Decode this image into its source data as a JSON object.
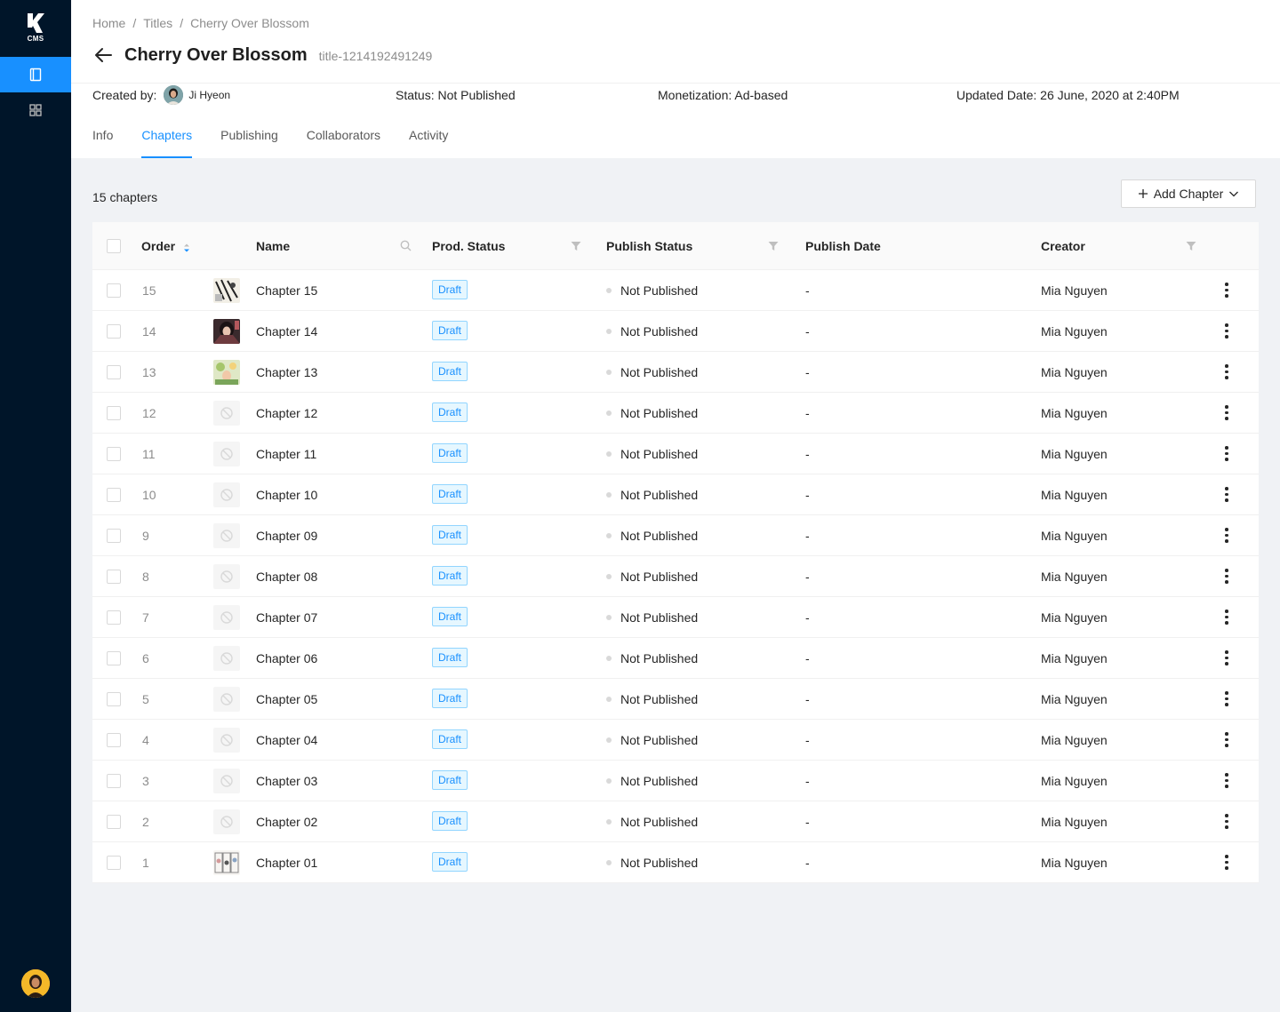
{
  "app": {
    "logo_text": "CMS"
  },
  "breadcrumb": [
    "Home",
    "Titles",
    "Cherry Over Blossom"
  ],
  "title": {
    "name": "Cherry Over Blossom",
    "id": "title-1214192491249"
  },
  "meta": {
    "created_by_label": "Created by:",
    "created_by_user": "Ji Hyeon",
    "status": "Status: Not Published",
    "monetization": "Monetization: Ad-based",
    "updated": "Updated Date: 26 June, 2020 at 2:40PM"
  },
  "tabs": [
    {
      "label": "Info",
      "active": false
    },
    {
      "label": "Chapters",
      "active": true
    },
    {
      "label": "Publishing",
      "active": false
    },
    {
      "label": "Collaborators",
      "active": false
    },
    {
      "label": "Activity",
      "active": false
    }
  ],
  "chapter_count": "15 chapters",
  "add_button": "Add Chapter",
  "columns": {
    "order": "Order",
    "name": "Name",
    "prod_status": "Prod. Status",
    "publish_status": "Publish Status",
    "publish_date": "Publish Date",
    "creator": "Creator"
  },
  "rows": [
    {
      "order": "15",
      "name": "Chapter 15",
      "prod_status": "Draft",
      "publish_status": "Not Published",
      "publish_date": "-",
      "creator": "Mia Nguyen",
      "thumb": "manga-a"
    },
    {
      "order": "14",
      "name": "Chapter 14",
      "prod_status": "Draft",
      "publish_status": "Not Published",
      "publish_date": "-",
      "creator": "Mia Nguyen",
      "thumb": "manga-b"
    },
    {
      "order": "13",
      "name": "Chapter 13",
      "prod_status": "Draft",
      "publish_status": "Not Published",
      "publish_date": "-",
      "creator": "Mia Nguyen",
      "thumb": "manga-c"
    },
    {
      "order": "12",
      "name": "Chapter 12",
      "prod_status": "Draft",
      "publish_status": "Not Published",
      "publish_date": "-",
      "creator": "Mia Nguyen",
      "thumb": "none"
    },
    {
      "order": "11",
      "name": "Chapter 11",
      "prod_status": "Draft",
      "publish_status": "Not Published",
      "publish_date": "-",
      "creator": "Mia Nguyen",
      "thumb": "none"
    },
    {
      "order": "10",
      "name": "Chapter 10",
      "prod_status": "Draft",
      "publish_status": "Not Published",
      "publish_date": "-",
      "creator": "Mia Nguyen",
      "thumb": "none"
    },
    {
      "order": "9",
      "name": "Chapter 09",
      "prod_status": "Draft",
      "publish_status": "Not Published",
      "publish_date": "-",
      "creator": "Mia Nguyen",
      "thumb": "none"
    },
    {
      "order": "8",
      "name": "Chapter 08",
      "prod_status": "Draft",
      "publish_status": "Not Published",
      "publish_date": "-",
      "creator": "Mia Nguyen",
      "thumb": "none"
    },
    {
      "order": "7",
      "name": "Chapter 07",
      "prod_status": "Draft",
      "publish_status": "Not Published",
      "publish_date": "-",
      "creator": "Mia Nguyen",
      "thumb": "none"
    },
    {
      "order": "6",
      "name": "Chapter 06",
      "prod_status": "Draft",
      "publish_status": "Not Published",
      "publish_date": "-",
      "creator": "Mia Nguyen",
      "thumb": "none"
    },
    {
      "order": "5",
      "name": "Chapter 05",
      "prod_status": "Draft",
      "publish_status": "Not Published",
      "publish_date": "-",
      "creator": "Mia Nguyen",
      "thumb": "none"
    },
    {
      "order": "4",
      "name": "Chapter 04",
      "prod_status": "Draft",
      "publish_status": "Not Published",
      "publish_date": "-",
      "creator": "Mia Nguyen",
      "thumb": "none"
    },
    {
      "order": "3",
      "name": "Chapter 03",
      "prod_status": "Draft",
      "publish_status": "Not Published",
      "publish_date": "-",
      "creator": "Mia Nguyen",
      "thumb": "none"
    },
    {
      "order": "2",
      "name": "Chapter 02",
      "prod_status": "Draft",
      "publish_status": "Not Published",
      "publish_date": "-",
      "creator": "Mia Nguyen",
      "thumb": "none"
    },
    {
      "order": "1",
      "name": "Chapter 01",
      "prod_status": "Draft",
      "publish_status": "Not Published",
      "publish_date": "-",
      "creator": "Mia Nguyen",
      "thumb": "manga-d"
    }
  ],
  "colors": {
    "accent": "#1890ff",
    "sidebar": "#001529",
    "draft_bg": "#e6f7ff"
  }
}
